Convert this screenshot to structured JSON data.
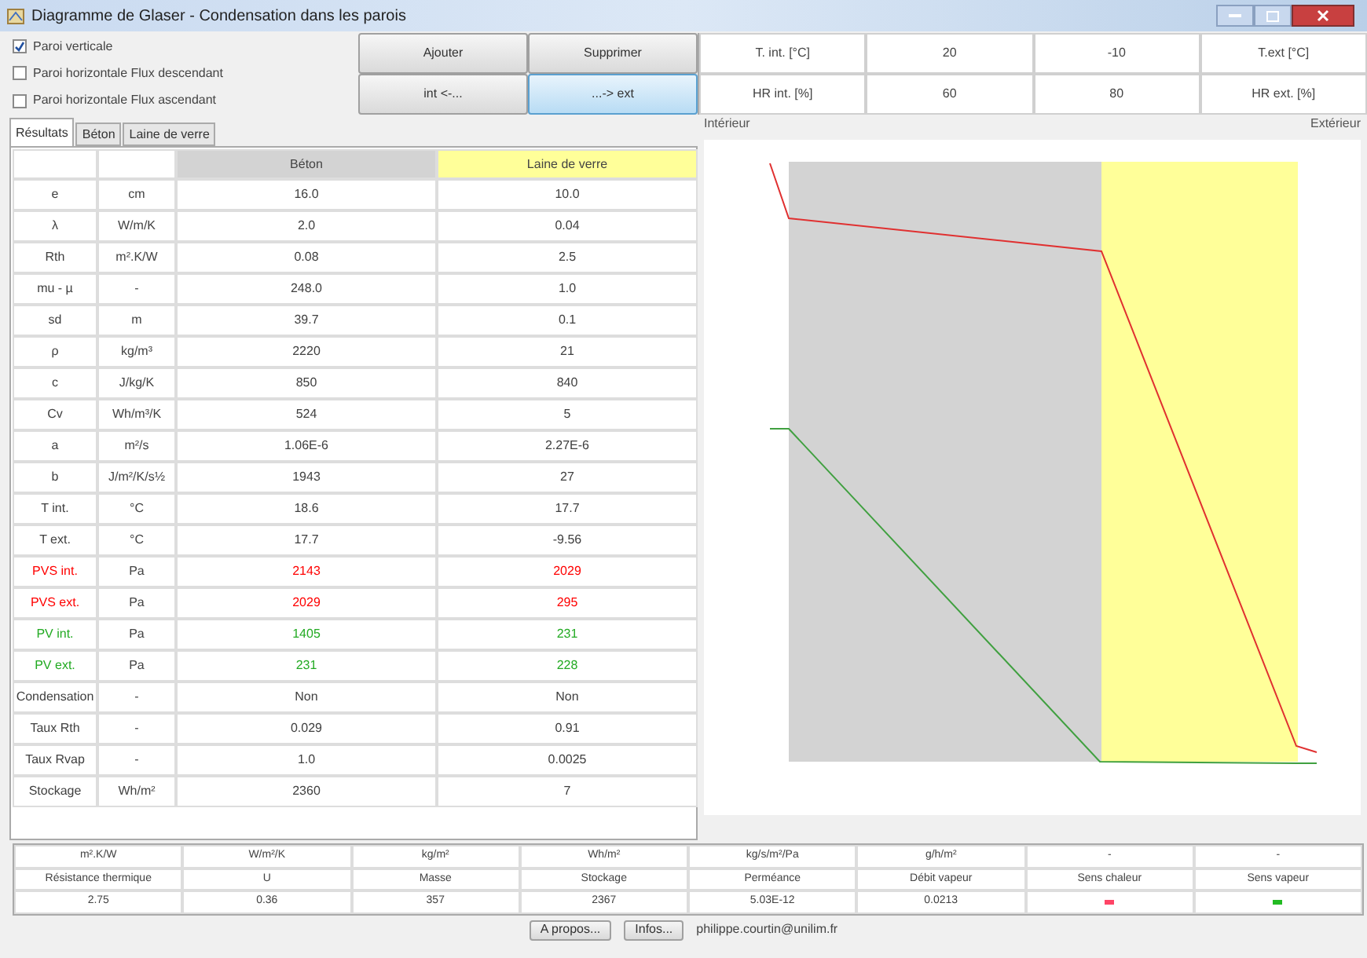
{
  "window": {
    "title": "Diagramme de Glaser - Condensation dans les parois"
  },
  "wall_types": [
    {
      "label": "Paroi verticale",
      "checked": true
    },
    {
      "label": "Paroi horizontale Flux descendant",
      "checked": false
    },
    {
      "label": "Paroi horizontale Flux ascendant",
      "checked": false
    }
  ],
  "buttons": [
    {
      "label": "Ajouter",
      "selected": false
    },
    {
      "label": "Supprimer",
      "selected": false
    },
    {
      "label": "int <-...",
      "selected": false
    },
    {
      "label": "...-> ext",
      "selected": true
    }
  ],
  "conditions": [
    [
      "T. int. [°C]",
      "20",
      "-10",
      "T.ext [°C]"
    ],
    [
      "HR int. [%]",
      "60",
      "80",
      "HR ext. [%]"
    ]
  ],
  "tabs": [
    {
      "label": "Résultats",
      "selected": true
    },
    {
      "label": "Béton",
      "selected": false
    },
    {
      "label": "Laine de verre",
      "selected": false
    }
  ],
  "diagram": {
    "left_label": "Intérieur",
    "right_label": "Extérieur"
  },
  "layers": [
    {
      "name": "Béton",
      "color": "#d3d3d3"
    },
    {
      "name": "Laine de verre",
      "color": "#ffff99"
    }
  ],
  "rows": [
    {
      "label": "e",
      "unit": "cm",
      "values": [
        "16.0",
        "10.0"
      ],
      "color": "#404040"
    },
    {
      "label": "λ",
      "unit": "W/m/K",
      "values": [
        "2.0",
        "0.04"
      ],
      "color": "#404040"
    },
    {
      "label": "Rth",
      "unit": "m².K/W",
      "values": [
        "0.08",
        "2.5"
      ],
      "color": "#404040"
    },
    {
      "label": "mu - µ",
      "unit": "-",
      "values": [
        "248.0",
        "1.0"
      ],
      "color": "#404040"
    },
    {
      "label": "sd",
      "unit": "m",
      "values": [
        "39.7",
        "0.1"
      ],
      "color": "#404040"
    },
    {
      "label": "ρ",
      "unit": "kg/m³",
      "values": [
        "2220",
        "21"
      ],
      "color": "#404040"
    },
    {
      "label": "c",
      "unit": "J/kg/K",
      "values": [
        "850",
        "840"
      ],
      "color": "#404040"
    },
    {
      "label": "Cv",
      "unit": "Wh/m³/K",
      "values": [
        "524",
        "5"
      ],
      "color": "#404040"
    },
    {
      "label": "a",
      "unit": "m²/s",
      "values": [
        "1.06E-6",
        "2.27E-6"
      ],
      "color": "#404040"
    },
    {
      "label": "b",
      "unit": "J/m²/K/s½",
      "values": [
        "1943",
        "27"
      ],
      "color": "#404040"
    },
    {
      "label": "T int.",
      "unit": "°C",
      "values": [
        "18.6",
        "17.7"
      ],
      "color": "#404040"
    },
    {
      "label": "T ext.",
      "unit": "°C",
      "values": [
        "17.7",
        "-9.56"
      ],
      "color": "#404040"
    },
    {
      "label": "PVS int.",
      "unit": "Pa",
      "values": [
        "2143",
        "2029"
      ],
      "color": "#ff0000"
    },
    {
      "label": "PVS ext.",
      "unit": "Pa",
      "values": [
        "2029",
        "295"
      ],
      "color": "#ff0000"
    },
    {
      "label": "PV int.",
      "unit": "Pa",
      "values": [
        "1405",
        "231"
      ],
      "color": "#22aa22"
    },
    {
      "label": "PV ext.",
      "unit": "Pa",
      "values": [
        "231",
        "228"
      ],
      "color": "#22aa22"
    },
    {
      "label": "Condensation",
      "unit": "-",
      "values": [
        "Non",
        "Non"
      ],
      "color": "#404040"
    },
    {
      "label": "Taux Rth",
      "unit": "-",
      "values": [
        "0.029",
        "0.91"
      ],
      "color": "#404040"
    },
    {
      "label": "Taux Rvap",
      "unit": "-",
      "values": [
        "1.0",
        "0.0025"
      ],
      "color": "#404040"
    },
    {
      "label": "Stockage",
      "unit": "Wh/m²",
      "values": [
        "2360",
        "7"
      ],
      "color": "#404040"
    }
  ],
  "summary": [
    {
      "unit": "m².K/W",
      "label": "Résistance thermique",
      "value": "2.75",
      "color": "#404040"
    },
    {
      "unit": "W/m²/K",
      "label": "U",
      "value": "0.36",
      "color": "#404040"
    },
    {
      "unit": "kg/m²",
      "label": "Masse",
      "value": "357",
      "color": "#404040"
    },
    {
      "unit": "Wh/m²",
      "label": "Stockage",
      "value": "2367",
      "color": "#404040"
    },
    {
      "unit": "kg/s/m²/Pa",
      "label": "Perméance",
      "value": "5.03E-12",
      "color": "#404040"
    },
    {
      "unit": "g/h/m²",
      "label": "Débit vapeur",
      "value": "0.0213",
      "color": "#404040"
    },
    {
      "unit": "-",
      "label": "Sens chaleur",
      "kind": "marker",
      "color": "#ff4466"
    },
    {
      "unit": "-",
      "label": "Sens vapeur",
      "kind": "marker",
      "color": "#22bb22"
    }
  ],
  "footer": {
    "buttons": [
      "A propos...",
      "Infos..."
    ],
    "email": "philippe.courtin@unilim.fr"
  }
}
